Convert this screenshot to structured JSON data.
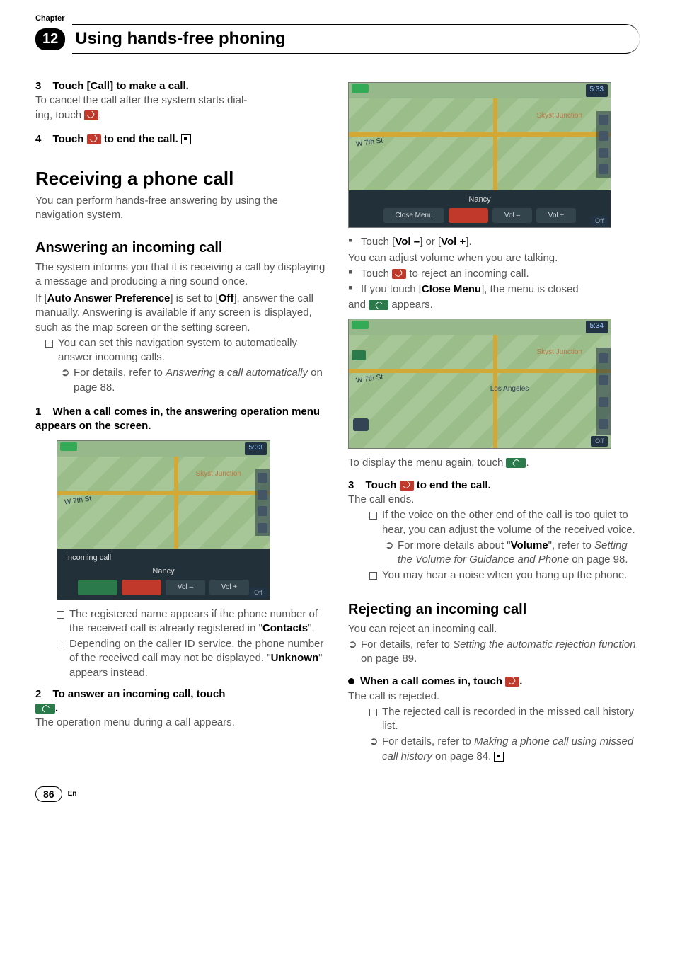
{
  "header": {
    "chapter_label": "Chapter",
    "chapter_number": "12",
    "title": "Using hands-free phoning"
  },
  "left": {
    "s3_num": "3",
    "s3_text": "Touch [Call] to make a call.",
    "s3_body1": "To cancel the call after the system starts dial-",
    "s3_body2": "ing, touch ",
    "s3_body3": ".",
    "s4_num": "4",
    "s4_text_a": "Touch ",
    "s4_text_b": " to end the call.",
    "h1": "Receiving a phone call",
    "h1_body": "You can perform hands-free answering by using the navigation system.",
    "h2": "Answering an incoming call",
    "h2_body1": "The system informs you that it is receiving a call by displaying a message and producing a ring sound once.",
    "h2_body2a": "If [",
    "h2_body2b": "Auto Answer Preference",
    "h2_body2c": "] is set to [",
    "h2_body2d": "Off",
    "h2_body2e": "], answer the call manually. Answering is available if any screen is displayed, such as the map screen or the setting screen.",
    "bul1": "You can set this navigation system to automatically answer incoming calls.",
    "bul1_sub_a": "For details, refer to ",
    "bul1_sub_b": "Answering a call automatically",
    "bul1_sub_c": " on page 88.",
    "step1_num": "1",
    "step1_text": "When a call comes in, the answering operation menu appears on the screen.",
    "ss1": {
      "clock": "5:33",
      "street": "W 7th St",
      "area": "Skyst Junction",
      "bar_label": "Incoming call",
      "name": "Nancy",
      "vol_minus": "Vol –",
      "vol_plus": "Vol +",
      "off": "Off"
    },
    "under_ss_b1a": "The registered name appears if the phone number of the received call is already registered in \"",
    "under_ss_b1b": "Contacts",
    "under_ss_b1c": "\".",
    "under_ss_b2a": "Depending on the caller ID service, the phone number of the received call may not be displayed. \"",
    "under_ss_b2b": "Unknown",
    "under_ss_b2c": "\" appears instead.",
    "step2_num": "2",
    "step2_text_a": "To answer an incoming call, touch",
    "step2_text_b": ".",
    "step2_body": "The operation menu during a call appears."
  },
  "right": {
    "ss2": {
      "clock": "5:33",
      "street": "W 7th St",
      "area": "Skyst Junction",
      "name": "Nancy",
      "close": "Close Menu",
      "vol_minus": "Vol –",
      "vol_plus": "Vol +",
      "off": "Off"
    },
    "b1_a": "Touch [",
    "b1_b": "Vol –",
    "b1_c": "] or [",
    "b1_d": "Vol +",
    "b1_e": "].",
    "b1_body": "You can adjust volume when you are talking.",
    "b2_a": "Touch ",
    "b2_b": " to reject an incoming call.",
    "b3_a": "If you touch [",
    "b3_b": "Close Menu",
    "b3_c": "], the menu is closed",
    "b3_d": "and ",
    "b3_e": " appears.",
    "ss3": {
      "clock": "5:34",
      "street": "W 7th St",
      "area": "Skyst Junction",
      "la": "Los Angeles",
      "off": "Off"
    },
    "after_ss3_a": "To display the menu again, touch ",
    "after_ss3_b": ".",
    "step3_num": "3",
    "step3_text_a": "Touch ",
    "step3_text_b": " to end the call.",
    "step3_body": "The call ends.",
    "step3_b1": "If the voice on the other end of the call is too quiet to hear, you can adjust the volume of the received voice.",
    "step3_b1_sub_a": "For more details about \"",
    "step3_b1_sub_b": "Volume",
    "step3_b1_sub_c": "\", refer to ",
    "step3_b1_sub_d": "Setting the Volume for Guidance and Phone",
    "step3_b1_sub_e": " on page 98.",
    "step3_b2": "You may hear a noise when you hang up the phone.",
    "h2b": "Rejecting an incoming call",
    "h2b_body": "You can reject an incoming call.",
    "h2b_sub_a": "For details, refer to ",
    "h2b_sub_b": "Setting the automatic rejection function",
    "h2b_sub_c": " on page 89.",
    "bullet_step_a": "When a call comes in, touch ",
    "bullet_step_b": ".",
    "bullet_step_body": "The call is rejected.",
    "rej_b1": "The rejected call is recorded in the missed call history list.",
    "rej_sub_a": "For details, refer to ",
    "rej_sub_b": "Making a phone call using missed call history",
    "rej_sub_c": " on page 84."
  },
  "footer": {
    "page": "86",
    "lang": "En"
  }
}
